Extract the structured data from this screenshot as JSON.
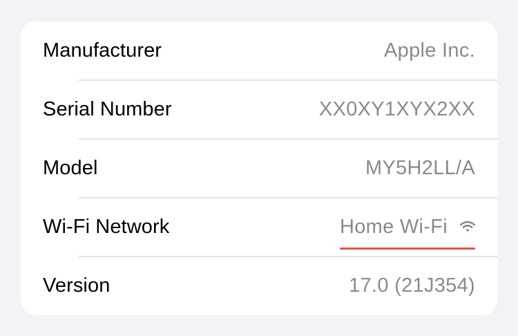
{
  "about": {
    "rows": [
      {
        "label": "Manufacturer",
        "value": "Apple Inc."
      },
      {
        "label": "Serial Number",
        "value": "XX0XY1XYX2XX"
      },
      {
        "label": "Model",
        "value": "MY5H2LL/A"
      },
      {
        "label": "Wi-Fi Network",
        "value": "Home Wi-Fi",
        "icon": "wifi-icon"
      },
      {
        "label": "Version",
        "value": "17.0 (21J354)"
      }
    ]
  },
  "colors": {
    "background": "#f2f2f7",
    "card": "#ffffff",
    "label": "#000000",
    "value": "#8a8a8e",
    "highlight_underline": "#e8523c"
  }
}
